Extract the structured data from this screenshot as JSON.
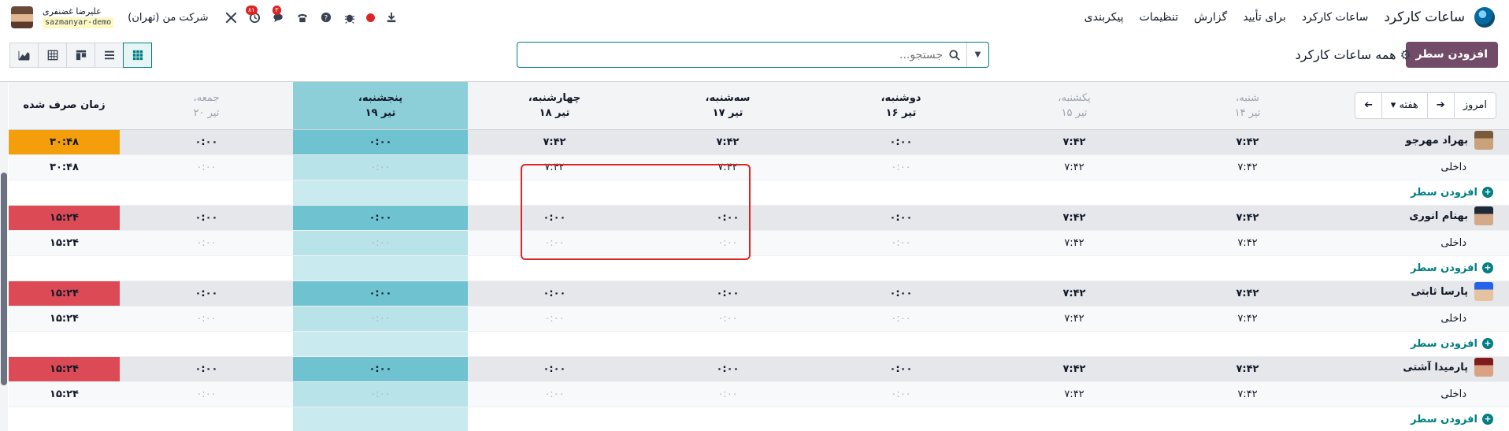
{
  "navbar": {
    "app_title": "ساعات کارکرد",
    "menu": [
      "ساعات کارکرد",
      "برای تأیید",
      "گزارش",
      "تنظیمات",
      "پیکربندی"
    ],
    "company": "شرکت من (تهران)",
    "user_name": "علیرضا غضنفری",
    "db_name": "sazmanyar-demo",
    "activity_badge": "۸۱",
    "messages_badge": "۳"
  },
  "controls": {
    "add_button": "افزودن سطر",
    "view_title": "همه ساعات کارکرد",
    "search_placeholder": "جستجو..."
  },
  "grid": {
    "nav": {
      "today": "امروز",
      "period": "هفته"
    },
    "total_header": "زمان صرف شده",
    "days": [
      {
        "day": "شنبه،",
        "date": "تیر ۱۴",
        "kind": "weekend"
      },
      {
        "day": "یکشنبه،",
        "date": "تیر ۱۵",
        "kind": "weekend"
      },
      {
        "day": "دوشنبه،",
        "date": "تیر ۱۶",
        "kind": "normal"
      },
      {
        "day": "سه‌شنبه،",
        "date": "تیر ۱۷",
        "kind": "normal"
      },
      {
        "day": "چهارشنبه،",
        "date": "تیر ۱۸",
        "kind": "normal"
      },
      {
        "day": "پنجشنبه،",
        "date": "تیر ۱۹",
        "kind": "today"
      },
      {
        "day": "جمعه،",
        "date": "تیر ۲۰",
        "kind": "weekend"
      }
    ],
    "task_label": "داخلی",
    "add_line_label": "افزودن سطر",
    "employees": [
      {
        "name": "بهراد مهرجو",
        "photo_colors": [
          "#7a5a3a",
          "#c9a27a"
        ],
        "emp_values": [
          "۷:۴۲",
          "۷:۴۲",
          "۰:۰۰",
          "۷:۴۲",
          "۷:۴۲",
          "۰:۰۰",
          "۰:۰۰"
        ],
        "emp_classes": [
          "v-warn",
          "v-warn",
          "v-zero-dark",
          "v-warn",
          "v-warn",
          "v-zero-dark",
          "v-zero-dark"
        ],
        "emp_total": "۳۰:۴۸",
        "total_style": "tot-orange",
        "task_values": [
          "۷:۴۲",
          "۷:۴۲",
          "۰:۰۰",
          "۷:۴۲",
          "۷:۴۲",
          "۰:۰۰",
          "۰:۰۰"
        ],
        "task_classes": [
          "v-ok",
          "v-ok",
          "v-zero-gray",
          "v-ok",
          "v-ok",
          "v-zero-gray",
          "v-zero-gray"
        ],
        "task_total": "۳۰:۴۸",
        "task_cells_blank": [
          false,
          false,
          false,
          false,
          false,
          false,
          false
        ]
      },
      {
        "name": "بهنام انوری",
        "photo_colors": [
          "#1f2937",
          "#d4a988"
        ],
        "emp_values": [
          "۷:۴۲",
          "۷:۴۲",
          "۰:۰۰",
          "۰:۰۰",
          "۰:۰۰",
          "۰:۰۰",
          "۰:۰۰"
        ],
        "emp_classes": [
          "v-ok",
          "v-ok",
          "v-zero-red",
          "v-zero-red",
          "v-zero-red",
          "v-zero-red",
          "v-zero-dark"
        ],
        "emp_total": "۱۵:۲۴",
        "total_style": "tot-red",
        "task_values": [
          "۷:۴۲",
          "۷:۴۲",
          "۰:۰۰",
          "۰:۰۰",
          "۰:۰۰",
          "۰:۰۰",
          "۰:۰۰"
        ],
        "task_classes": [
          "v-ok",
          "v-ok",
          "v-zero-gray",
          "v-zero-gray",
          "v-zero-gray",
          "v-zero-gray",
          "v-zero-gray"
        ],
        "task_total": "۱۵:۲۴"
      },
      {
        "name": "پارسا ثابتی",
        "photo_colors": [
          "#2563eb",
          "#e5c3a0"
        ],
        "emp_values": [
          "۷:۴۲",
          "۷:۴۲",
          "۰:۰۰",
          "۰:۰۰",
          "۰:۰۰",
          "۰:۰۰",
          "۰:۰۰"
        ],
        "emp_classes": [
          "v-ok",
          "v-ok",
          "v-zero-red",
          "v-zero-red",
          "v-zero-red",
          "v-zero-red",
          "v-zero-dark"
        ],
        "emp_total": "۱۵:۲۴",
        "total_style": "tot-red",
        "task_values": [
          "۷:۴۲",
          "۷:۴۲",
          "۰:۰۰",
          "۰:۰۰",
          "۰:۰۰",
          "۰:۰۰",
          "۰:۰۰"
        ],
        "task_classes": [
          "v-ok",
          "v-ok",
          "v-zero-gray",
          "v-zero-gray",
          "v-zero-gray",
          "v-zero-gray",
          "v-zero-gray"
        ],
        "task_total": "۱۵:۲۴"
      },
      {
        "name": "پارمیدا آشتی",
        "photo_colors": [
          "#7f1d1d",
          "#d9a383"
        ],
        "emp_values": [
          "۷:۴۲",
          "۷:۴۲",
          "۰:۰۰",
          "۰:۰۰",
          "۰:۰۰",
          "۰:۰۰",
          "۰:۰۰"
        ],
        "emp_classes": [
          "v-ok",
          "v-ok",
          "v-zero-red",
          "v-zero-red",
          "v-zero-red",
          "v-zero-red",
          "v-zero-dark"
        ],
        "emp_total": "۱۵:۲۴",
        "total_style": "tot-red",
        "task_values": [
          "۷:۴۲",
          "۷:۴۲",
          "۰:۰۰",
          "۰:۰۰",
          "۰:۰۰",
          "۰:۰۰",
          "۰:۰۰"
        ],
        "task_classes": [
          "v-ok",
          "v-ok",
          "v-zero-gray",
          "v-zero-gray",
          "v-zero-gray",
          "v-zero-gray",
          "v-zero-gray"
        ],
        "task_total": "۱۵:۲۴"
      }
    ]
  },
  "colors": {
    "brand": "#714b67",
    "accent": "#017e84",
    "today": "#6fc2cf",
    "warn_total": "#f59e0b",
    "bad_total": "#dc4a55"
  },
  "icons": [
    "app-logo-icon",
    "settings-gear-icon",
    "search-icon",
    "caret-down-icon",
    "arrow-left-icon",
    "arrow-right-icon",
    "plus-circle-icon",
    "tools-icon",
    "activity-icon",
    "chat-icon",
    "phone-icon",
    "help-icon",
    "bug-icon",
    "record-icon",
    "download-icon",
    "grid-view-icon",
    "list-view-icon",
    "kanban-view-icon",
    "pivot-view-icon",
    "graph-view-icon"
  ]
}
